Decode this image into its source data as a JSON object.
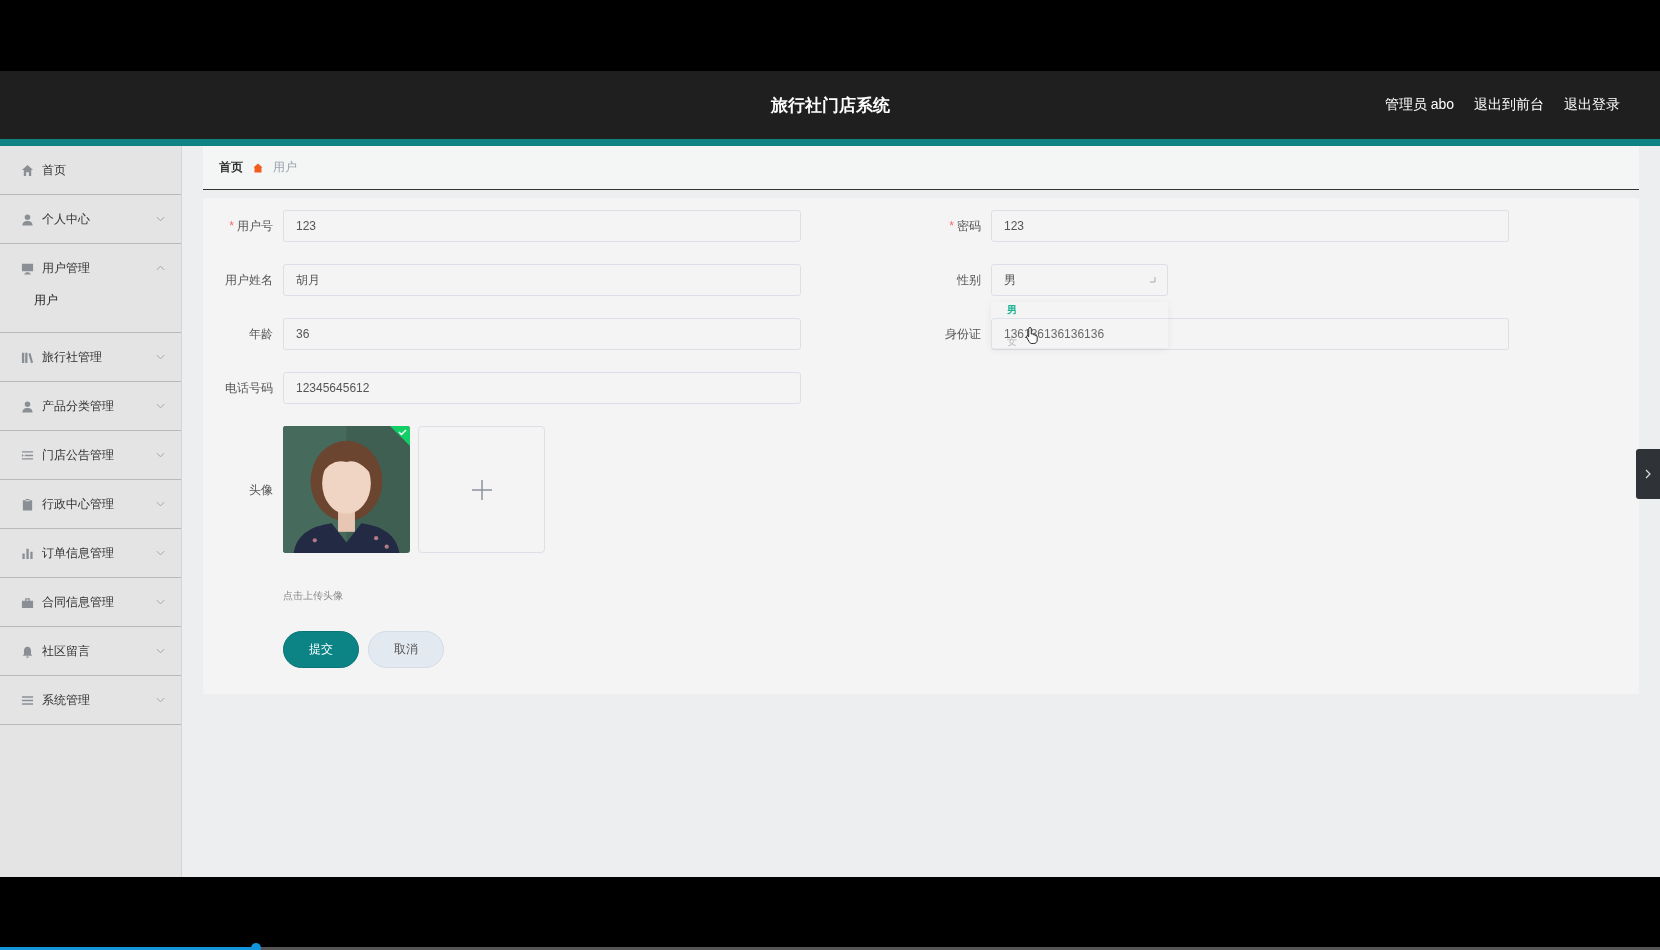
{
  "header": {
    "title": "旅行社门店系统",
    "links": [
      "管理员 abo",
      "退出到前台",
      "退出登录"
    ]
  },
  "sidebar": {
    "items": [
      {
        "label": "首页",
        "kind": "link"
      },
      {
        "label": "个人中心",
        "kind": "menu",
        "expanded": false
      },
      {
        "label": "用户管理",
        "kind": "menu",
        "expanded": true,
        "children": [
          {
            "label": "用户"
          }
        ]
      },
      {
        "label": "旅行社管理",
        "kind": "menu",
        "expanded": false
      },
      {
        "label": "产品分类管理",
        "kind": "menu",
        "expanded": false
      },
      {
        "label": "门店公告管理",
        "kind": "menu",
        "expanded": false
      },
      {
        "label": "行政中心管理",
        "kind": "menu",
        "expanded": false
      },
      {
        "label": "订单信息管理",
        "kind": "menu",
        "expanded": false
      },
      {
        "label": "合同信息管理",
        "kind": "menu",
        "expanded": false
      },
      {
        "label": "社区留言",
        "kind": "menu",
        "expanded": false
      },
      {
        "label": "系统管理",
        "kind": "menu",
        "expanded": false
      }
    ]
  },
  "breadcrumb": [
    {
      "label": "首页",
      "current": false
    },
    {
      "label": "用户",
      "current": true
    }
  ],
  "form": {
    "fields": [
      {
        "label": "用户号",
        "required_mark": "*",
        "kind": "text",
        "value": "123"
      },
      {
        "label": "密码",
        "required_mark": "*",
        "kind": "text",
        "value": "123"
      },
      {
        "label": "用户姓名",
        "kind": "text",
        "value": "胡月"
      },
      {
        "label": "性别",
        "kind": "select",
        "value": "男",
        "open": true,
        "options": [
          {
            "label": "男",
            "selected": true
          },
          {
            "label": "女",
            "selected": false
          }
        ]
      },
      {
        "label": "年龄",
        "kind": "text",
        "value": "36"
      },
      {
        "label": "身份证",
        "kind": "text",
        "value": "136136136136136"
      },
      {
        "label": "电话号码",
        "kind": "text",
        "value": "12345645612"
      }
    ],
    "avatar": {
      "label": "头像",
      "uploaded": true,
      "hint": "点击上传头像"
    },
    "buttons": [
      {
        "label": "提交",
        "kind": "primary"
      },
      {
        "label": "取消",
        "kind": "secondary"
      }
    ]
  },
  "player": {
    "level": 0.154
  }
}
